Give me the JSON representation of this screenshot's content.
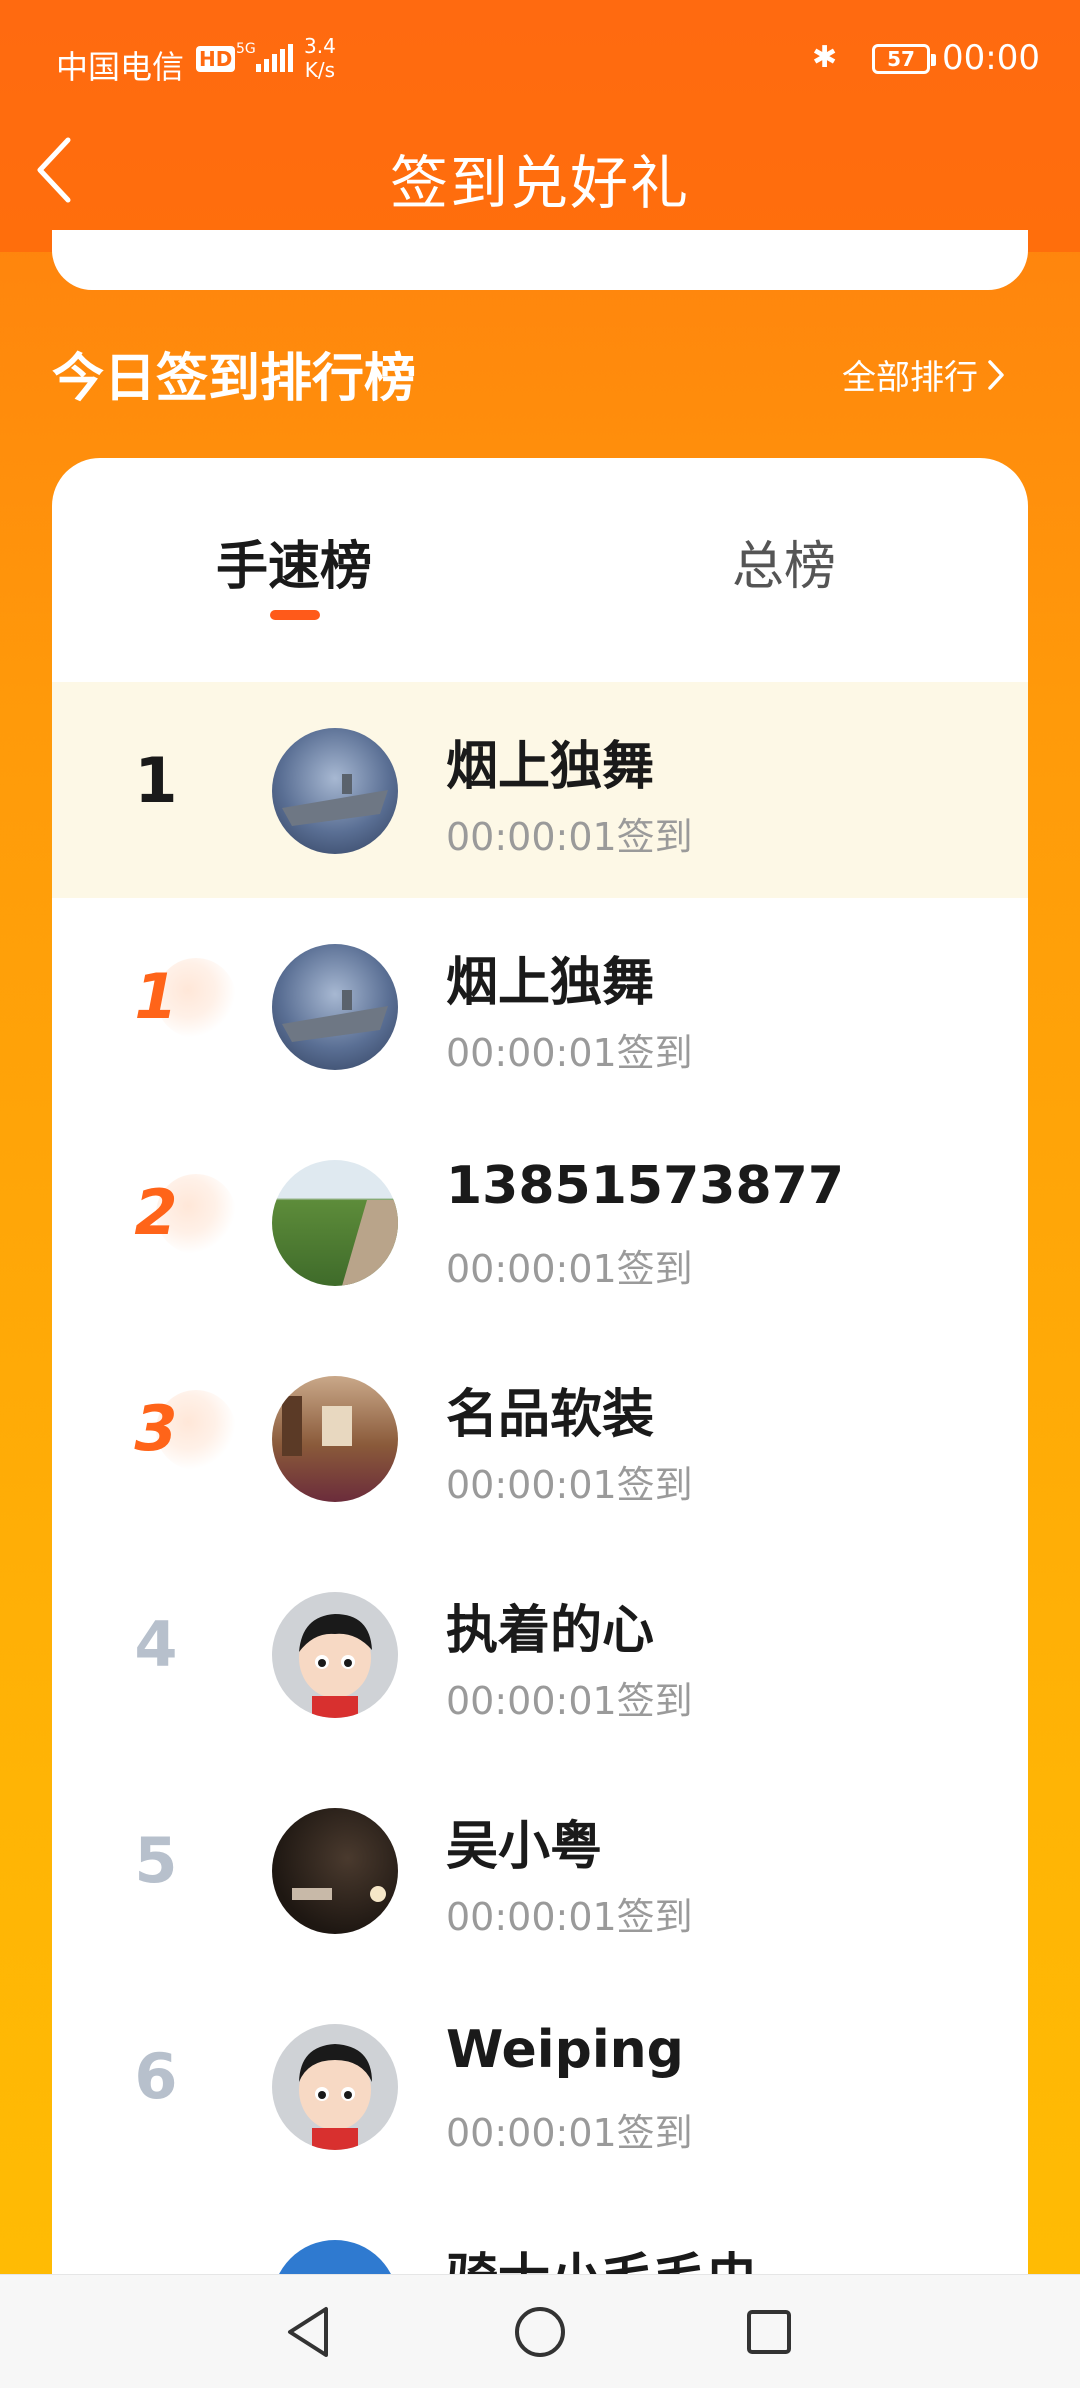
{
  "status_bar": {
    "carrier": "中国电信",
    "hd": "HD",
    "network": "5G",
    "speed_value": "3.4",
    "speed_unit": "K/s",
    "battery": "57",
    "time": "00:00"
  },
  "header": {
    "title": "签到兑好礼"
  },
  "ranking": {
    "title": "今日签到排行榜",
    "all_link": "全部排行",
    "tabs": [
      {
        "label": "手速榜",
        "active": true
      },
      {
        "label": "总榜",
        "active": false
      }
    ],
    "rows": [
      {
        "rank": "1",
        "name": "烟上独舞",
        "time": "00:00:01签到",
        "avatar": "aircraft-carrier-photo",
        "highlight": true,
        "rank_style": "plain"
      },
      {
        "rank": "1",
        "name": "烟上独舞",
        "time": "00:00:01签到",
        "avatar": "aircraft-carrier-photo",
        "rank_style": "medal"
      },
      {
        "rank": "2",
        "name": "13851573877",
        "time": "00:00:01签到",
        "avatar": "field-road-photo",
        "rank_style": "medal"
      },
      {
        "rank": "3",
        "name": "名品软装",
        "time": "00:00:01签到",
        "avatar": "showroom-photo",
        "rank_style": "medal"
      },
      {
        "rank": "4",
        "name": "执着的心",
        "time": "00:00:01签到",
        "avatar": "cartoon-girl-avatar",
        "rank_style": "grey"
      },
      {
        "rank": "5",
        "name": "吴小粤",
        "time": "00:00:01签到",
        "avatar": "night-photo",
        "rank_style": "grey"
      },
      {
        "rank": "6",
        "name": "Weiping",
        "time": "00:00:01签到",
        "avatar": "cartoon-boy-avatar",
        "rank_style": "grey"
      },
      {
        "rank": "",
        "name": "骑士小毛毛虫",
        "time": "",
        "avatar": "blue-avatar",
        "rank_style": "grey"
      }
    ]
  },
  "colors": {
    "header_orange": "#ff6a10",
    "accent": "#ff5a1a",
    "highlight_row": "#fdf8e6"
  }
}
